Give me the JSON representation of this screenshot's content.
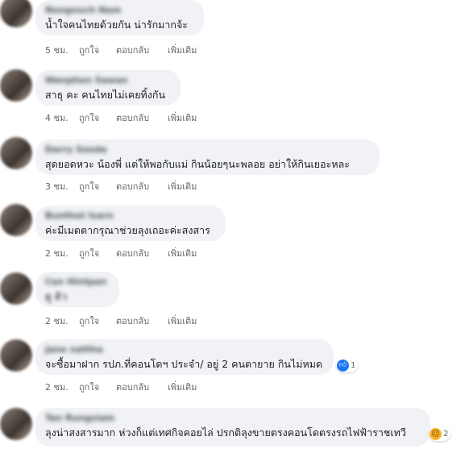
{
  "comments": [
    {
      "name": "Nongnuch Nam",
      "text": "น้ำใจคนไทยด้วยกัน น่ารักมากจ้ะ",
      "time": "5 ชม.",
      "like": "ถูกใจ",
      "reply": "ตอบกลับ",
      "more": "เพิ่มเติม"
    },
    {
      "name": "Wanphen Sawan",
      "text": "สาธุ คะ คนไทยไม่เคยทิ้งกัน",
      "time": "4 ชม.",
      "like": "ถูกใจ",
      "reply": "ตอบกลับ",
      "more": "เพิ่มเติม"
    },
    {
      "name": "Darry Seeda",
      "text": "สุดยอดหวะ น้องพี่ แต่ให้พอกับแม่ กินน้อยๆนะพลอย อย่าให้กินเยอะหละ",
      "time": "3 ชม.",
      "like": "ถูกใจ",
      "reply": "ตอบกลับ",
      "more": "เพิ่มเติม"
    },
    {
      "name": "Bunthet Isarn",
      "text": "ค่ะมีเมตตากรุณาช่วยลุงเถอะค่ะสงสาร",
      "time": "2 ชม.",
      "like": "ถูกใจ",
      "reply": "ตอบกลับ",
      "more": "เพิ่มเติม"
    },
    {
      "name": "Cen Hintpan",
      "text": "ดู ดิว",
      "time": "2 ชม.",
      "like": "ถูกใจ",
      "reply": "ตอบกลับ",
      "more": "เพิ่มเติม"
    },
    {
      "name": "Jane nattha",
      "text": "จะซื้อมาฝาก รปภ.ที่คอนโดฯ ประจำ/ อยู่ 2 คนตายาย กินไม่หมด",
      "reaction_count": "1",
      "time": "2 ชม.",
      "like": "ถูกใจ",
      "reply": "ตอบกลับ",
      "more": "เพิ่มเติม"
    },
    {
      "name": "Tan Rungsiam",
      "text": "ลุงน่าสงสารมาก ห่วงก็แต่เทศกิจคอยไล่ ปรกติลุงขายตรงคอนโดตรงรถไฟฟ้าราชเทวี",
      "reaction_count": "2"
    }
  ],
  "icons": {
    "like_reaction": "like-thumb-icon",
    "sad_reaction": "sad-face-icon"
  },
  "colors": {
    "bubble": "#f0f2f5",
    "meta_text": "#65676b",
    "like_blue": "#1877f2",
    "sad_yellow": "#f7b125"
  }
}
